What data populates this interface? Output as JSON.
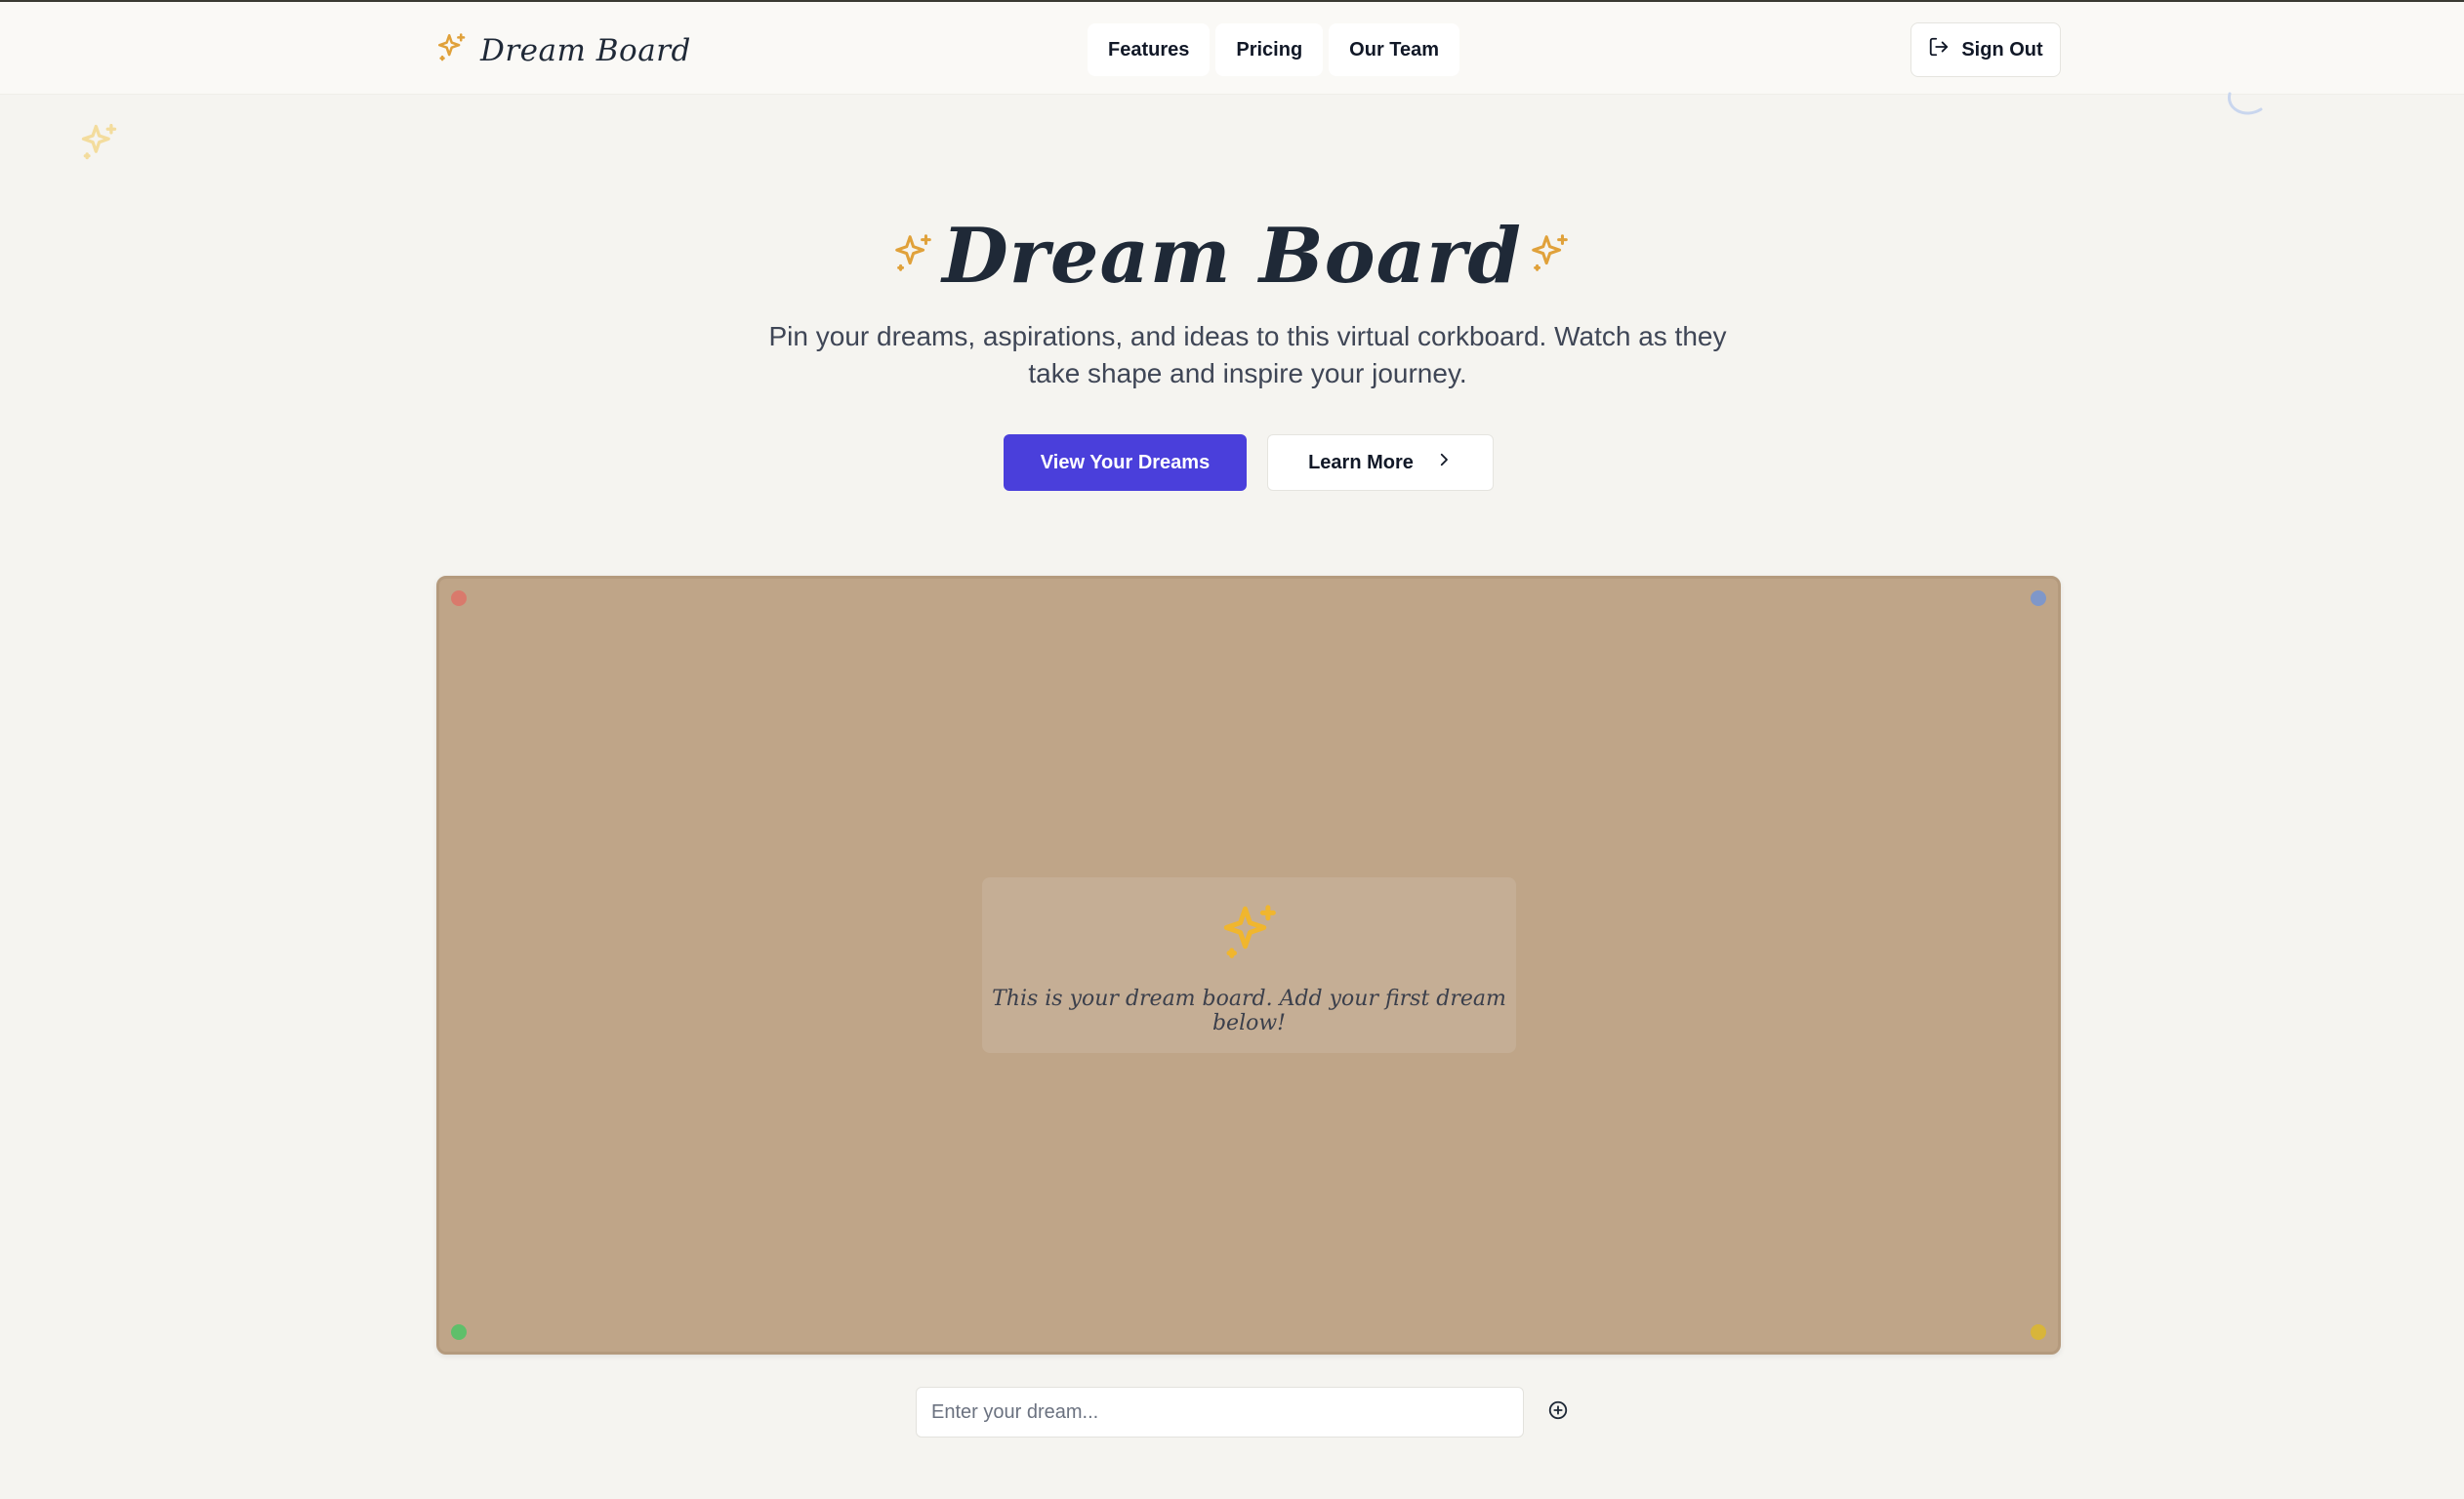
{
  "brand": {
    "name": "Dream Board",
    "icon": "sparkles-icon"
  },
  "nav": {
    "items": [
      {
        "label": "Features"
      },
      {
        "label": "Pricing"
      },
      {
        "label": "Our Team"
      }
    ]
  },
  "auth": {
    "sign_out_label": "Sign Out",
    "icon": "log-out-icon"
  },
  "hero": {
    "title": "Dream Board",
    "subtitle": "Pin your dreams, aspirations, and ideas to this virtual corkboard. Watch as they take shape and inspire your journey.",
    "primary_cta": "View Your Dreams",
    "secondary_cta": "Learn More"
  },
  "board": {
    "empty_message": "This is your dream board. Add your first dream below!",
    "pin_colors": [
      "#d97a6c",
      "#7f97c9",
      "#5fbf6a",
      "#d8b53a"
    ]
  },
  "composer": {
    "placeholder": "Enter your dream...",
    "value": "",
    "add_icon": "plus-circle-icon"
  },
  "colors": {
    "accent": "#4a3fdb",
    "star": "#e0a13a",
    "cork": "#bfa588",
    "background": "#f5f4f0"
  }
}
